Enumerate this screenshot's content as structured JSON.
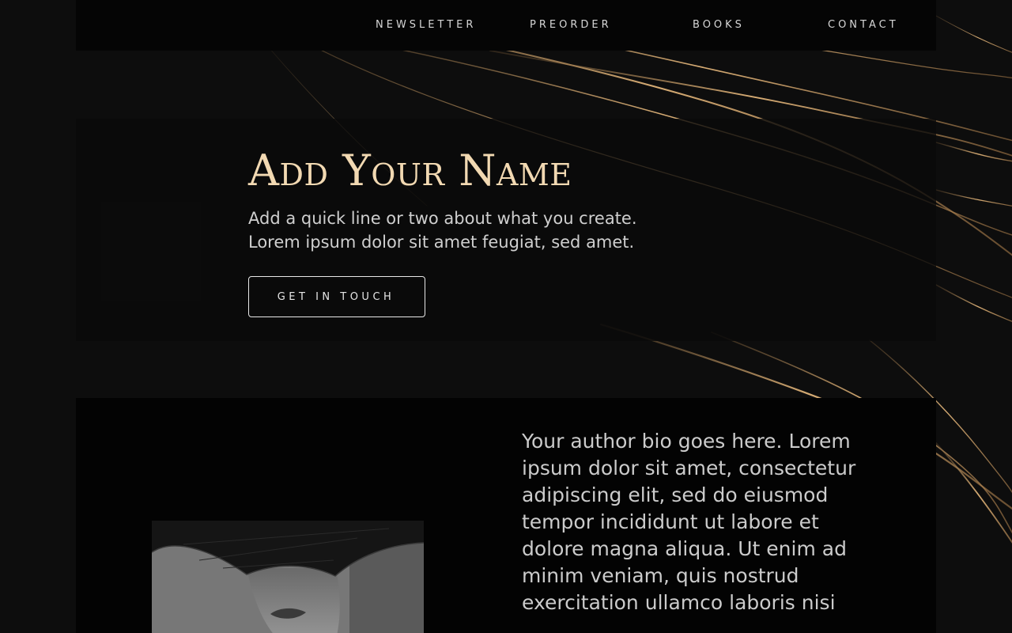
{
  "nav": {
    "items": [
      {
        "label": "NEWSLETTER"
      },
      {
        "label": "PREORDER"
      },
      {
        "label": "BOOKS"
      },
      {
        "label": "CONTACT"
      }
    ]
  },
  "hero": {
    "title": "Add Your Name",
    "lines": [
      "Add a quick line or two about what you create.",
      "Lorem ipsum dolor sit amet feugiat, sed amet."
    ],
    "cta_label": "GET IN TOUCH"
  },
  "about": {
    "bio": "Your author bio goes here. Lorem ipsum dolor sit amet, consectetur adipiscing elit, sed do eiusmod tempor incididunt ut labore et dolore magna aliqua. Ut enim ad minim veniam, quis nostrud exercitation ullamco laboris nisi"
  },
  "colors": {
    "background": "#0d0d0d",
    "panel": "#050505",
    "accent_gold": "#f2d9b2",
    "text": "#d8d8d8"
  }
}
